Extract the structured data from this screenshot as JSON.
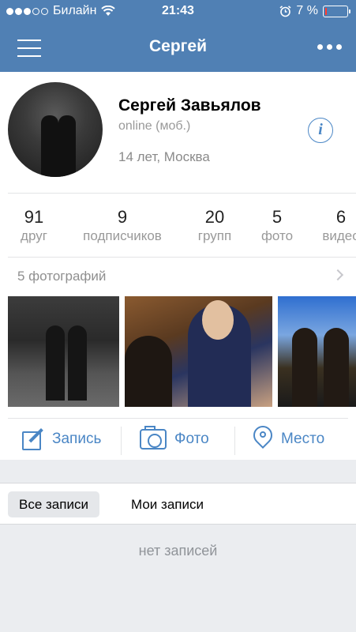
{
  "status_bar": {
    "carrier": "Билайн",
    "time": "21:43",
    "battery_percent": "7 %",
    "battery_level": 0.07,
    "signal_bars_filled": 3,
    "signal_bars_total": 5
  },
  "nav": {
    "title": "Сергей",
    "menu_icon": "hamburger-icon",
    "more_icon": "more-dots-icon"
  },
  "profile": {
    "name": "Сергей Завьялов",
    "online_status": "online (моб.)",
    "age_city": "14 лет, Москва",
    "info_icon": "info-icon",
    "info_glyph": "i"
  },
  "stats": [
    {
      "count": "91",
      "label": "друг"
    },
    {
      "count": "9",
      "label": "подписчиков"
    },
    {
      "count": "20",
      "label": "групп"
    },
    {
      "count": "5",
      "label": "фото"
    },
    {
      "count": "6",
      "label": "видео"
    }
  ],
  "photos": {
    "header": "5 фотографий",
    "chevron_icon": "chevron-right-icon"
  },
  "actions": [
    {
      "label": "Запись",
      "icon": "pencil-icon"
    },
    {
      "label": "Фото",
      "icon": "camera-icon"
    },
    {
      "label": "Место",
      "icon": "location-pin-icon"
    }
  ],
  "posts": {
    "tabs": [
      {
        "label": "Все записи",
        "active": true
      },
      {
        "label": "Мои записи",
        "active": false
      }
    ],
    "empty_text": "нет записей"
  },
  "colors": {
    "header": "#5080b4",
    "accent": "#4a86c5",
    "battery_low": "#ff3b30"
  }
}
